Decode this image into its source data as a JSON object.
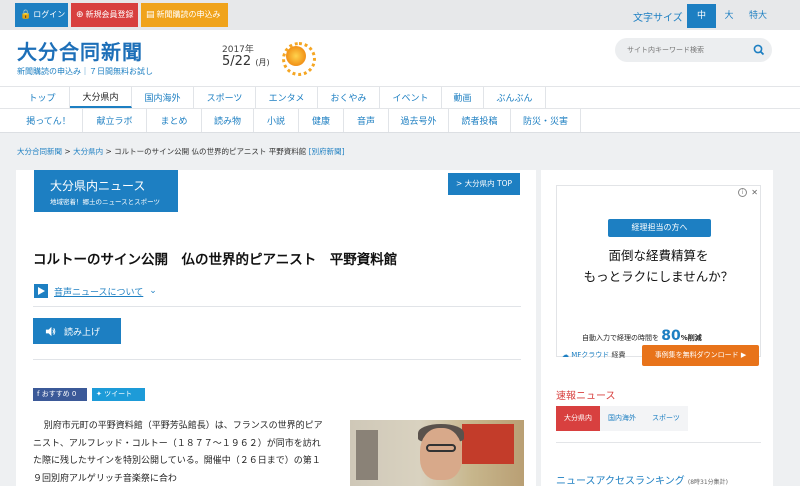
{
  "topbar": {
    "login": "ログイン",
    "register": "新規会員登録",
    "subscribe": "新聞購読の申込み",
    "font_size_label": "文字サイズ",
    "font_sizes": [
      "中",
      "大",
      "特大"
    ]
  },
  "header": {
    "logo": "大分合同新聞",
    "logo_sub": "新聞購読の申込み｜７日間無料お試し",
    "year": "2017年",
    "date": "5/22",
    "weekday": "(月)",
    "search_placeholder": "サイト内キーワード検索"
  },
  "nav_primary": [
    "トップ",
    "大分県内",
    "国内海外",
    "スポーツ",
    "エンタメ",
    "おくやみ",
    "イベント",
    "動画",
    "ぶんぶん"
  ],
  "nav_secondary": [
    "掲ってん！",
    "献立ラボ",
    "まとめ",
    "読み物",
    "小説",
    "健康",
    "音声",
    "過去号外",
    "読者投稿",
    "防災・災害"
  ],
  "breadcrumb": {
    "items": [
      "大分合同新聞",
      "大分県内"
    ],
    "separator": ">",
    "current": "コルトーのサイン公開 仏の世界的ピアニスト 平野資料館",
    "source": "[別府新聞]"
  },
  "section": {
    "title": "大分県内ニュース",
    "subtitle": "地域密着！郷土のニュースとスポーツ",
    "top_link": "> 大分県内 TOP"
  },
  "article": {
    "title": "コルトーのサイン公開　仏の世界的ピアニスト　平野資料館",
    "audio_news": "音声ニュースについて",
    "read_aloud": "読み上げ",
    "share_fb": "おすすめ 0",
    "share_tw": "ツイート",
    "body": "別府市元町の平野資料館（平野芳弘館長）は、フランスの世界的ピアニスト、アルフレッド・コルトー（１８７７～１９６２）が同市を訪れた際に残したサインを特別公開している。開催中（２６日まで）の第１９回別府アルゲリッチ音楽祭に合わ"
  },
  "ad": {
    "tag": "経理担当の方へ",
    "headline1": "面倒な経費精算を",
    "headline2": "もっとラクにしませんか？",
    "line_pre": "自動入力で経理の時間を",
    "line_big": "80",
    "line_post": "%削減",
    "brand": "MFクラウド",
    "brand_suffix": "経費",
    "cta": "事例集を無料ダウンロード ▶"
  },
  "sidebar": {
    "news_heading": "速報ニュース",
    "news_tabs": [
      "大分県内",
      "国内海外",
      "スポーツ"
    ],
    "ranking_heading": "ニュースアクセスランキング",
    "ranking_note": "(8時31分集計)"
  }
}
